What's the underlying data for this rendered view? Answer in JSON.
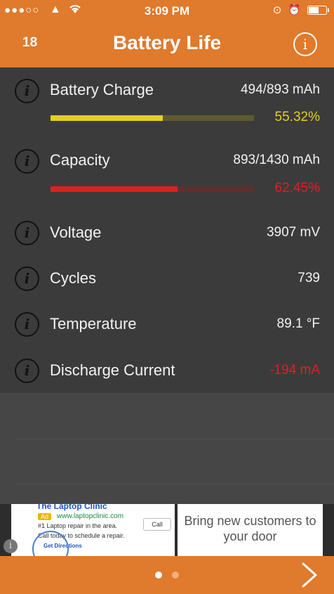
{
  "status_bar": {
    "signal": "●●●○○",
    "time": "3:09 PM"
  },
  "header": {
    "count": "18",
    "title": "Battery Life"
  },
  "rows": [
    {
      "label": "Battery Charge",
      "value": "494/893 mAh",
      "value_color": "#f2f2f2",
      "bar": {
        "percent_text": "55.32%",
        "fraction": 0.5532,
        "color": "#e5cf1f",
        "track_color": "#5e5a30"
      }
    },
    {
      "label": "Capacity",
      "value": "893/1430 mAh",
      "value_color": "#f2f2f2",
      "bar": {
        "percent_text": "62.45%",
        "fraction": 0.6245,
        "color": "#e02020",
        "track_color": "#5d3030"
      }
    },
    {
      "label": "Voltage",
      "value": "3907 mV",
      "value_color": "#f2f2f2"
    },
    {
      "label": "Cycles",
      "value": "739",
      "value_color": "#f2f2f2"
    },
    {
      "label": "Temperature",
      "value": "89.1 °F",
      "value_color": "#f2f2f2"
    },
    {
      "label": "Discharge Current",
      "value": "-194 mA",
      "value_color": "#e02020"
    }
  ],
  "ad": {
    "left": {
      "headline": "The Laptop Clinic",
      "badge": "Ad",
      "url": "www.laptopclinic.com",
      "line1": "#1 Laptop repair in the area.",
      "line2": "Call today to schedule a repair.",
      "directions": "Get Directions",
      "call": "Call"
    },
    "right_text": "Bring new customers to your door"
  },
  "pager": {
    "page": 1,
    "total": 2
  },
  "colors": {
    "accent": "#e07a2c",
    "warning_yellow": "#e5cf1f",
    "alert_red": "#e02020"
  }
}
